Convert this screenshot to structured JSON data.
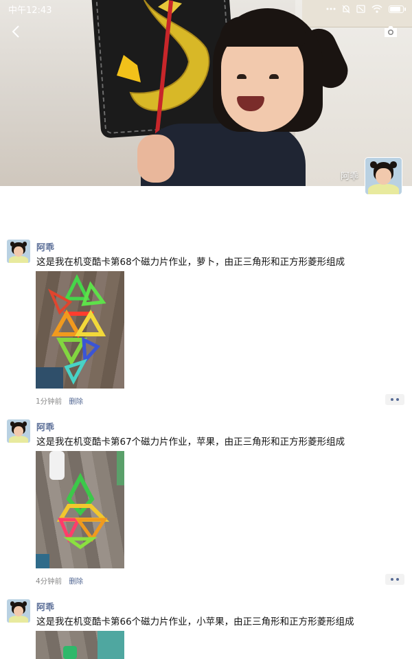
{
  "statusbar": {
    "time": "中午12:43",
    "battery_level": 0.9
  },
  "cover": {
    "name": "阿乖"
  },
  "posts": [
    {
      "name": "阿乖",
      "text": "这是我在机变酷卡第68个磁力片作业，萝卜，由正三角形和正方形菱形组成",
      "time": "1分钟前",
      "delete": "删除"
    },
    {
      "name": "阿乖",
      "text": "这是我在机变酷卡第67个磁力片作业，苹果，由正三角形和正方形菱形组成",
      "time": "4分钟前",
      "delete": "删除"
    },
    {
      "name": "阿乖",
      "text": "这是我在机变酷卡第66个磁力片作业，小苹果，由正三角形和正方形菱形组成"
    }
  ],
  "colors": {
    "link": "#576b95",
    "text": "#111111",
    "meta": "#8a8a8a"
  },
  "icons": [
    "back-chevron-icon",
    "camera-icon",
    "dots-icon",
    "mute-icon",
    "sim-icon",
    "wifi-icon",
    "battery-icon",
    "more-dots-icon"
  ]
}
